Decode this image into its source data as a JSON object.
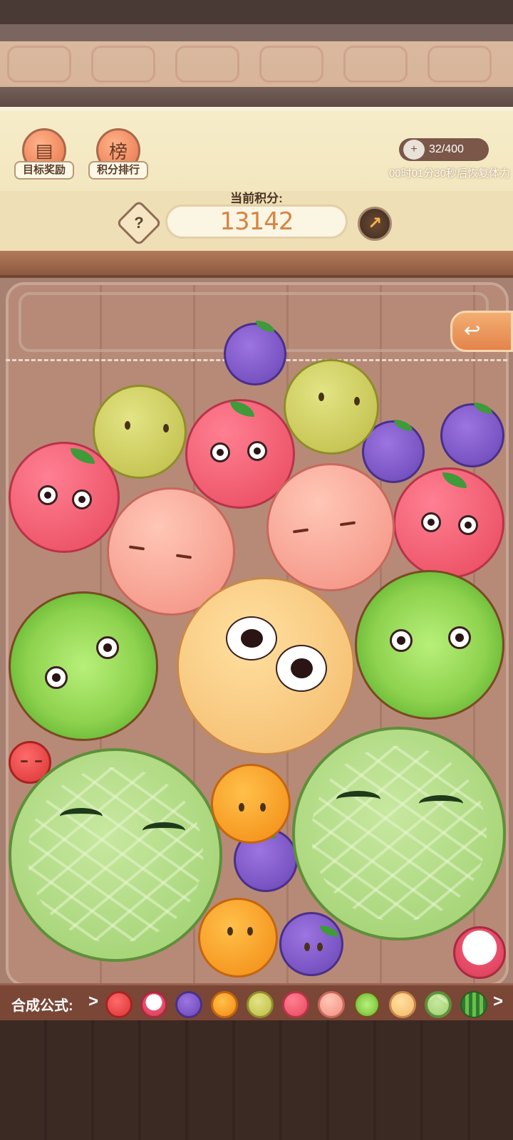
{
  "header": {
    "target_reward_label": "目标奖励",
    "score_rank_label": "积分排行",
    "energy": "32/400",
    "recover_text": "00时01分30秒后恢复体力",
    "score_title": "当前积分:",
    "score_value": "13142",
    "help_symbol": "?"
  },
  "formula_bar": {
    "label": "合成公式:",
    "arrow": ">",
    "fruits": [
      "cherry",
      "lychee",
      "grape",
      "orange",
      "lemon",
      "apple",
      "peach",
      "kiwi",
      "cantaloupe",
      "honeydew",
      "watermelon"
    ]
  },
  "colors": {
    "board": "#b68a77",
    "formula_bar": "#7a4636",
    "score_text": "#d58543"
  },
  "icons": {
    "target_reward": "treasure-chest-icon",
    "score_rank": "scroll-rank-icon",
    "energy": "energy-bun-icon",
    "help": "question-icon",
    "share": "share-arrow-icon",
    "back": "back-arrow-icon"
  }
}
